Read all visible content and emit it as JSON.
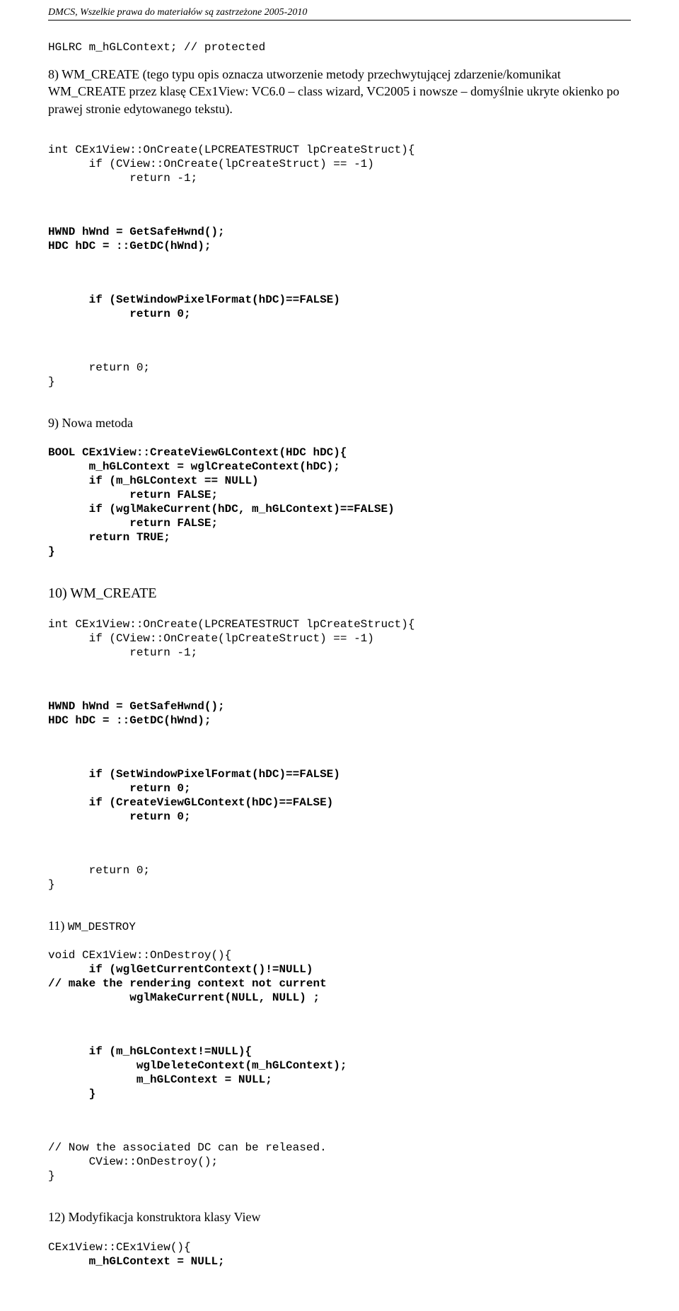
{
  "header": "DMCS, Wszelkie prawa do materiałów są zastrzeżone 2005-2010",
  "line1": "HGLRC m_hGLContext; // protected",
  "sect8": {
    "text": "8) WM_CREATE (tego typu opis oznacza utworzenie metody przechwytującej zdarzenie/komunikat WM_CREATE przez klasę CEx1View: VC6.0 – class wizard, VC2005 i nowsze – domyślnie ukryte okienko po prawej stronie edytowanego tekstu).",
    "c1": "int CEx1View::OnCreate(LPCREATESTRUCT lpCreateStruct){",
    "c2": "      if (CView::OnCreate(lpCreateStruct) == -1)",
    "c3": "            return -1;",
    "c4": "HWND hWnd = GetSafeHwnd();",
    "c5": "HDC hDC = ::GetDC(hWnd);",
    "c6": "      if (SetWindowPixelFormat(hDC)==FALSE)",
    "c7": "            return 0;",
    "c8": "      return 0;",
    "c9": "}"
  },
  "sect9": {
    "hdr": "9) Nowa metoda",
    "c1": "BOOL CEx1View::CreateViewGLContext(HDC hDC){",
    "c2": "      m_hGLContext = wglCreateContext(hDC);",
    "c3": "      if (m_hGLContext == NULL)",
    "c4": "            return FALSE;",
    "c5": "      if (wglMakeCurrent(hDC, m_hGLContext)==FALSE)",
    "c6": "            return FALSE;",
    "c7": "      return TRUE;",
    "c8": "}"
  },
  "sect10": {
    "hdr": "10) WM_CREATE",
    "c1": "int CEx1View::OnCreate(LPCREATESTRUCT lpCreateStruct){",
    "c2": "      if (CView::OnCreate(lpCreateStruct) == -1)",
    "c3": "            return -1;",
    "c4": "HWND hWnd = GetSafeHwnd();",
    "c5": "HDC hDC = ::GetDC(hWnd);",
    "c6": "      if (SetWindowPixelFormat(hDC)==FALSE)",
    "c7": "            return 0;",
    "c8": "      if (CreateViewGLContext(hDC)==FALSE)",
    "c9": "            return 0;",
    "c10": "      return 0;",
    "c11": "}"
  },
  "sect11": {
    "hdr": "11) WM_DESTROY",
    "c1": "void CEx1View::OnDestroy(){",
    "c2": "      if (wglGetCurrentContext()!=NULL)",
    "c3": "// make the rendering context not current",
    "c4": "            wglMakeCurrent(NULL, NULL) ;",
    "c5": "      if (m_hGLContext!=NULL){",
    "c6": "             wglDeleteContext(m_hGLContext);",
    "c7": "             m_hGLContext = NULL;",
    "c8": "      }",
    "c9": "// Now the associated DC can be released.",
    "c10": "      CView::OnDestroy();",
    "c11": "}"
  },
  "sect12": {
    "hdr": "12) Modyfikacja konstruktora klasy View",
    "c1": "CEx1View::CEx1View(){",
    "c2": "      m_hGLContext = NULL;"
  }
}
